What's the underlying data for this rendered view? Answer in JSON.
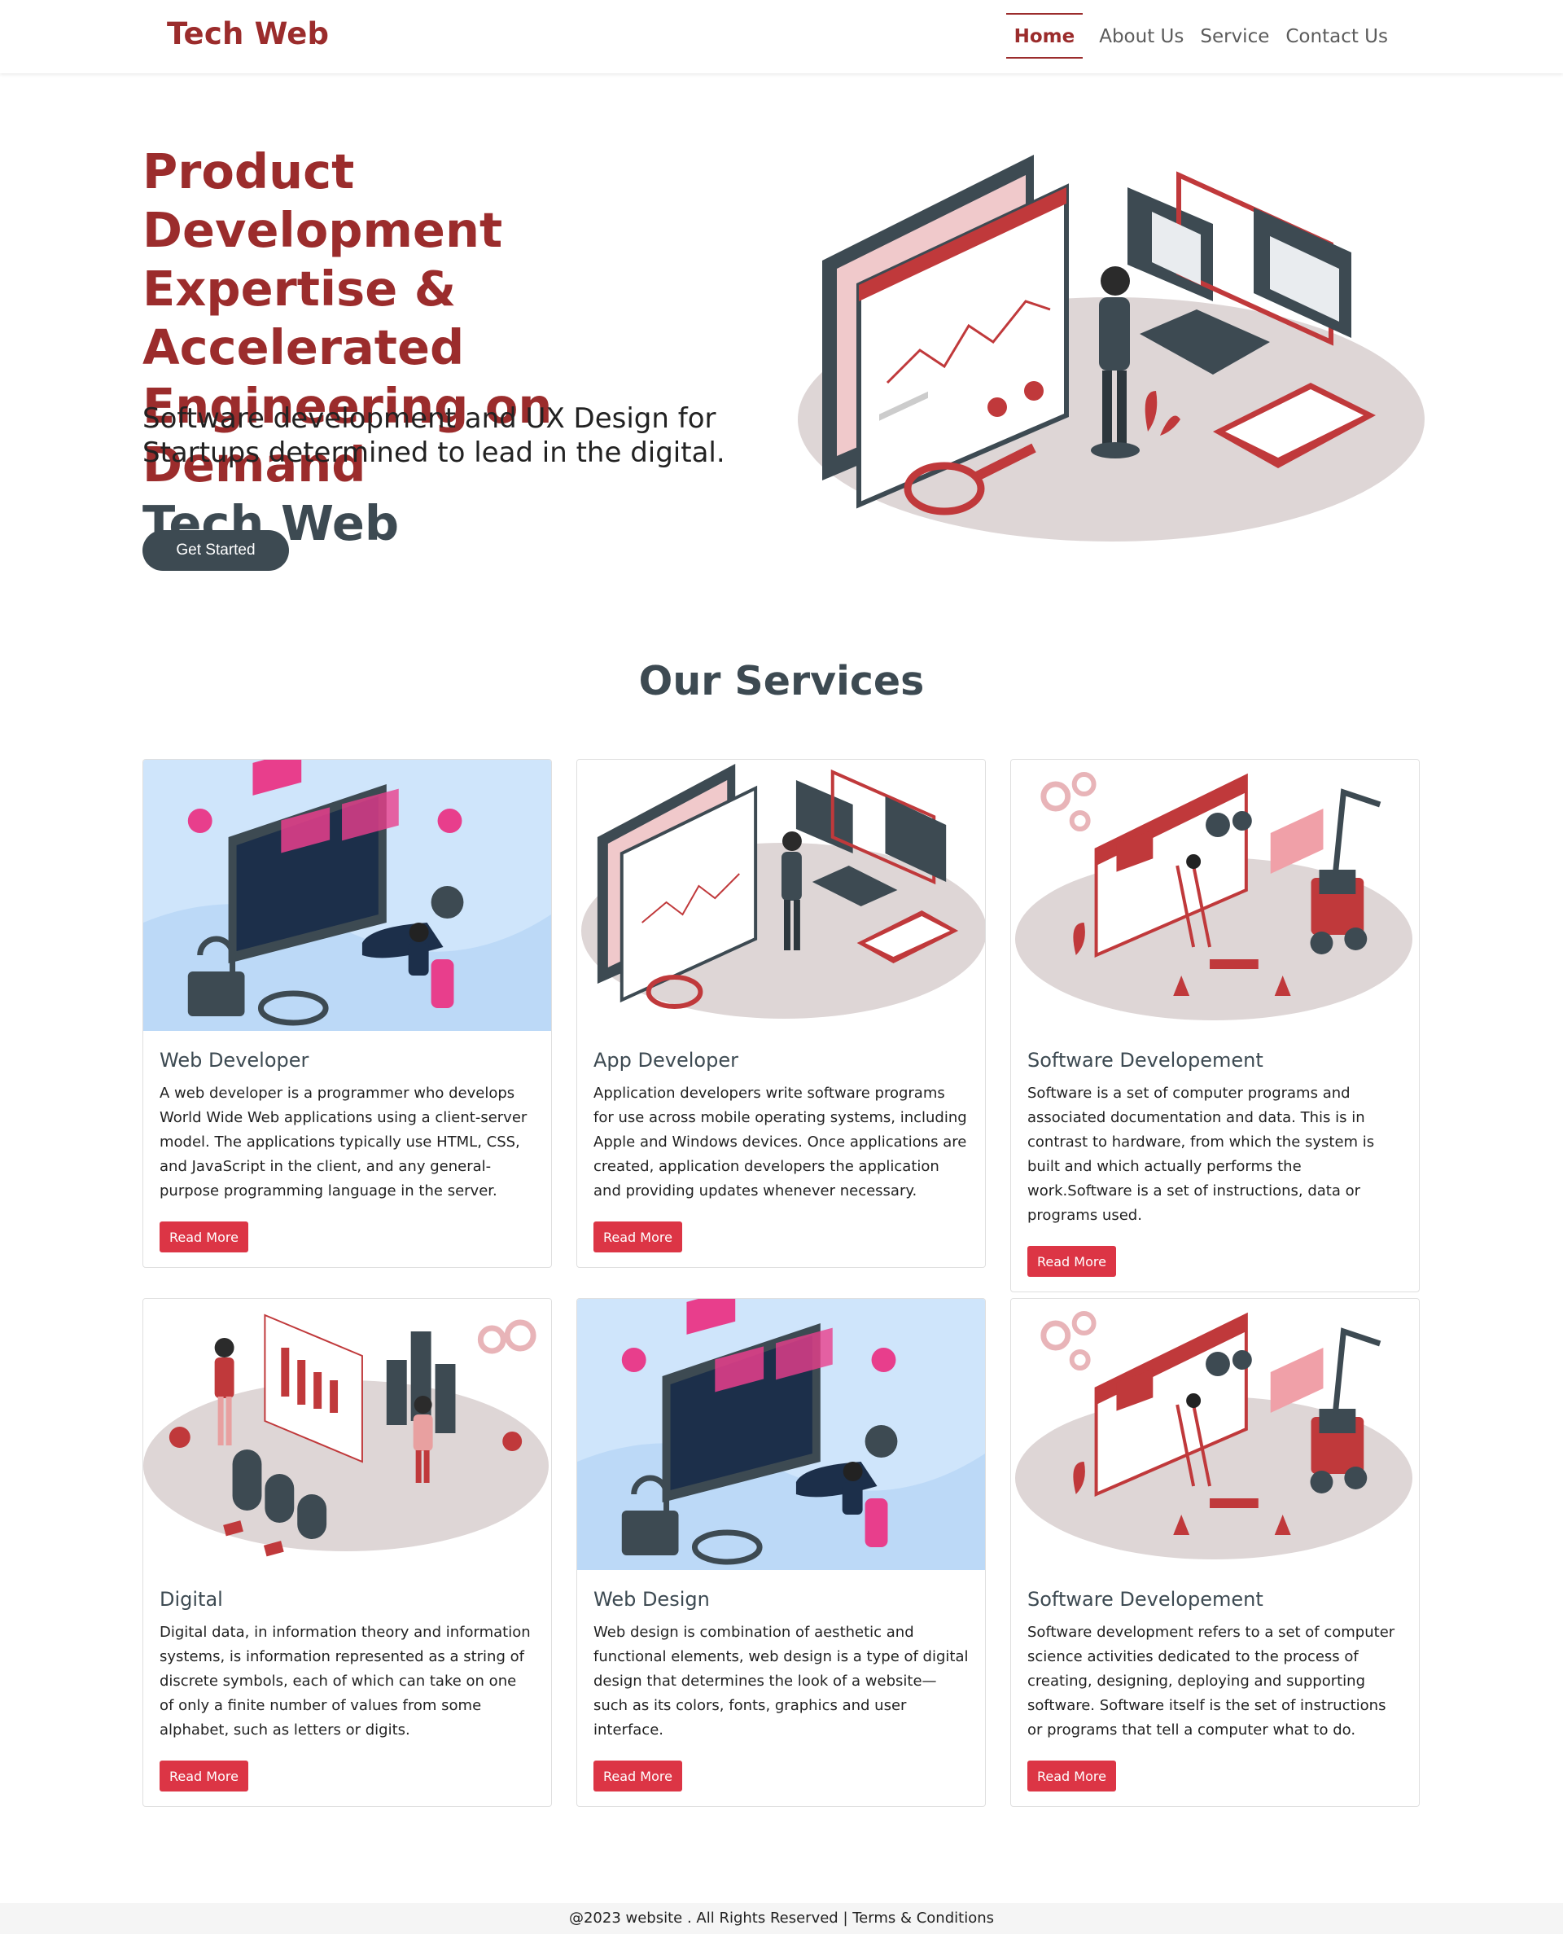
{
  "nav": {
    "brand": "Tech Web",
    "links": [
      "Home",
      "About Us",
      "Service",
      "Contact Us"
    ]
  },
  "hero": {
    "title_lines": [
      "Product Development",
      "Expertise & Accelerated",
      "Engineering on Demand"
    ],
    "title_dark": "Tech Web",
    "subtitle": "Software development and UX Design for Startups determined to lead in the digital.",
    "cta": "Get Started"
  },
  "services": {
    "title": "Our Services",
    "cards": [
      {
        "title": "Web Developer",
        "text": "A web developer is a programmer who develops World Wide Web applications using a client-server model. The applications typically use HTML, CSS, and JavaScript in the client, and any general-purpose programming language in the server.",
        "button": "Read More"
      },
      {
        "title": "App Developer",
        "text": "Application developers write software programs for use across mobile operating systems, including Apple and Windows devices. Once applications are created, application developers the application and providing updates whenever necessary.",
        "button": "Read More"
      },
      {
        "title": "Software Developement",
        "text": "Software is a set of computer programs and associated documentation and data. This is in contrast to hardware, from which the system is built and which actually performs the work.Software is a set of instructions, data or programs used.",
        "button": "Read More"
      },
      {
        "title": "Digital",
        "text": "Digital data, in information theory and information systems, is information represented as a string of discrete symbols, each of which can take on one of only a finite number of values from some alphabet, such as letters or digits.",
        "button": "Read More"
      },
      {
        "title": "Web Design",
        "text": "Web design is combination of aesthetic and functional elements, web design is a type of digital design that determines the look of a website—such as its colors, fonts, graphics and user interface.",
        "button": "Read More"
      },
      {
        "title": "Software Developement",
        "text": "Software development refers to a set of computer science activities dedicated to the process of creating, designing, deploying and supporting software. Software itself is the set of instructions or programs that tell a computer what to do.",
        "button": "Read More"
      }
    ]
  },
  "footer": {
    "text": "@2023 website . All Rights Reserved | Terms & Conditions"
  },
  "colors": {
    "brand_red": "#9b2c2c",
    "dark_slate": "#3d4a52",
    "button_red": "#dc3545",
    "light_blue_bg": "#cfe5fb",
    "platform_gray": "#ded6d6"
  }
}
